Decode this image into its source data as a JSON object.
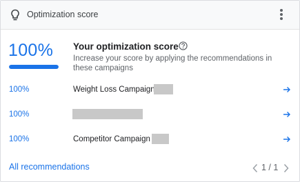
{
  "header": {
    "title": "Optimization score",
    "lightbulb_icon": "lightbulb-icon",
    "menu_icon": "more-vert-icon"
  },
  "score": {
    "value_label": "100%",
    "progress_fraction": 1.0,
    "title": "Your optimization score",
    "description": "Increase your score by applying the recommendations in these campaigns"
  },
  "campaigns": [
    {
      "score": "100%",
      "name": "Weight Loss Campaign"
    },
    {
      "score": "100%",
      "name": ""
    },
    {
      "score": "100%",
      "name": "Competitor Campaign"
    }
  ],
  "footer": {
    "all_recommendations": "All recommendations",
    "pagination": "1 / 1"
  },
  "colors": {
    "accent": "#1a73e8",
    "header_bg": "#f8f9fa",
    "redaction": "#c8c8c8"
  }
}
